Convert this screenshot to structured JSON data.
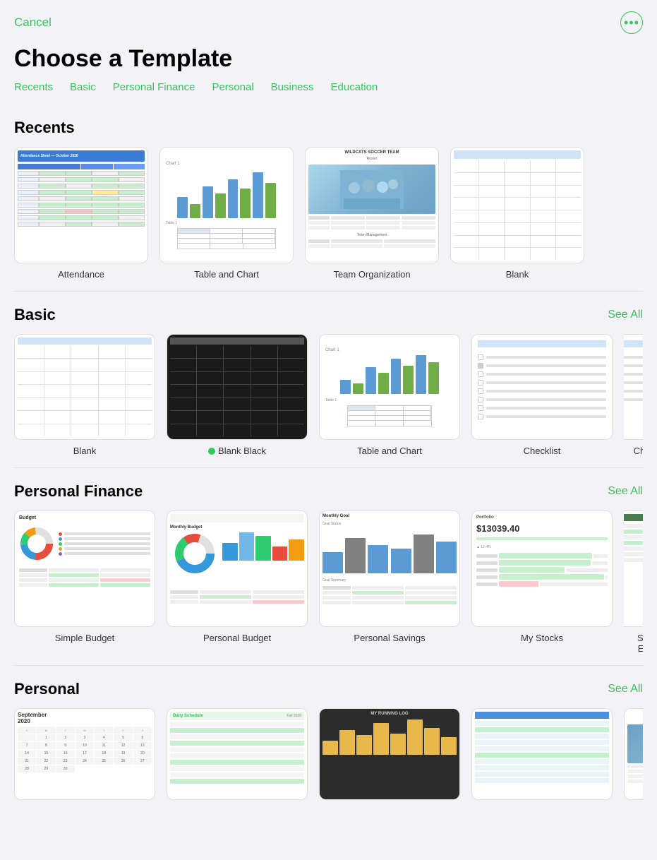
{
  "header": {
    "cancel_label": "Cancel",
    "title": "Choose a Template",
    "more_icon": "•••"
  },
  "nav": {
    "tabs": [
      {
        "id": "recents",
        "label": "Recents"
      },
      {
        "id": "basic",
        "label": "Basic"
      },
      {
        "id": "personal-finance",
        "label": "Personal Finance"
      },
      {
        "id": "personal",
        "label": "Personal"
      },
      {
        "id": "business",
        "label": "Business"
      },
      {
        "id": "education",
        "label": "Education"
      }
    ]
  },
  "sections": {
    "recents": {
      "title": "Recents",
      "templates": [
        {
          "id": "attendance",
          "label": "Attendance"
        },
        {
          "id": "table-and-chart",
          "label": "Table and Chart"
        },
        {
          "id": "team-organization",
          "label": "Team Organization"
        },
        {
          "id": "blank",
          "label": "Blank"
        }
      ]
    },
    "basic": {
      "title": "Basic",
      "see_all": "See All",
      "templates": [
        {
          "id": "blank-basic",
          "label": "Blank"
        },
        {
          "id": "blank-black",
          "label": "Blank Black",
          "has_dot": true
        },
        {
          "id": "table-and-chart-basic",
          "label": "Table and Chart"
        },
        {
          "id": "checklist",
          "label": "Checklist"
        },
        {
          "id": "checklist2",
          "label": "Checklist"
        }
      ]
    },
    "personal_finance": {
      "title": "Personal Finance",
      "see_all": "See All",
      "templates": [
        {
          "id": "simple-budget",
          "label": "Simple Budget"
        },
        {
          "id": "personal-budget",
          "label": "Personal Budget"
        },
        {
          "id": "personal-savings",
          "label": "Personal Savings"
        },
        {
          "id": "my-stocks",
          "label": "My Stocks"
        },
        {
          "id": "shared-expenses",
          "label": "Shared Expe..."
        }
      ]
    },
    "personal": {
      "title": "Personal",
      "see_all": "See All",
      "templates": [
        {
          "id": "calendar",
          "label": ""
        },
        {
          "id": "daily-schedule",
          "label": ""
        },
        {
          "id": "running-log",
          "label": ""
        },
        {
          "id": "remodel",
          "label": ""
        },
        {
          "id": "wildcats",
          "label": ""
        }
      ]
    }
  },
  "colors": {
    "green": "#34c759",
    "blue": "#007aff",
    "background": "#f2f2f7"
  }
}
